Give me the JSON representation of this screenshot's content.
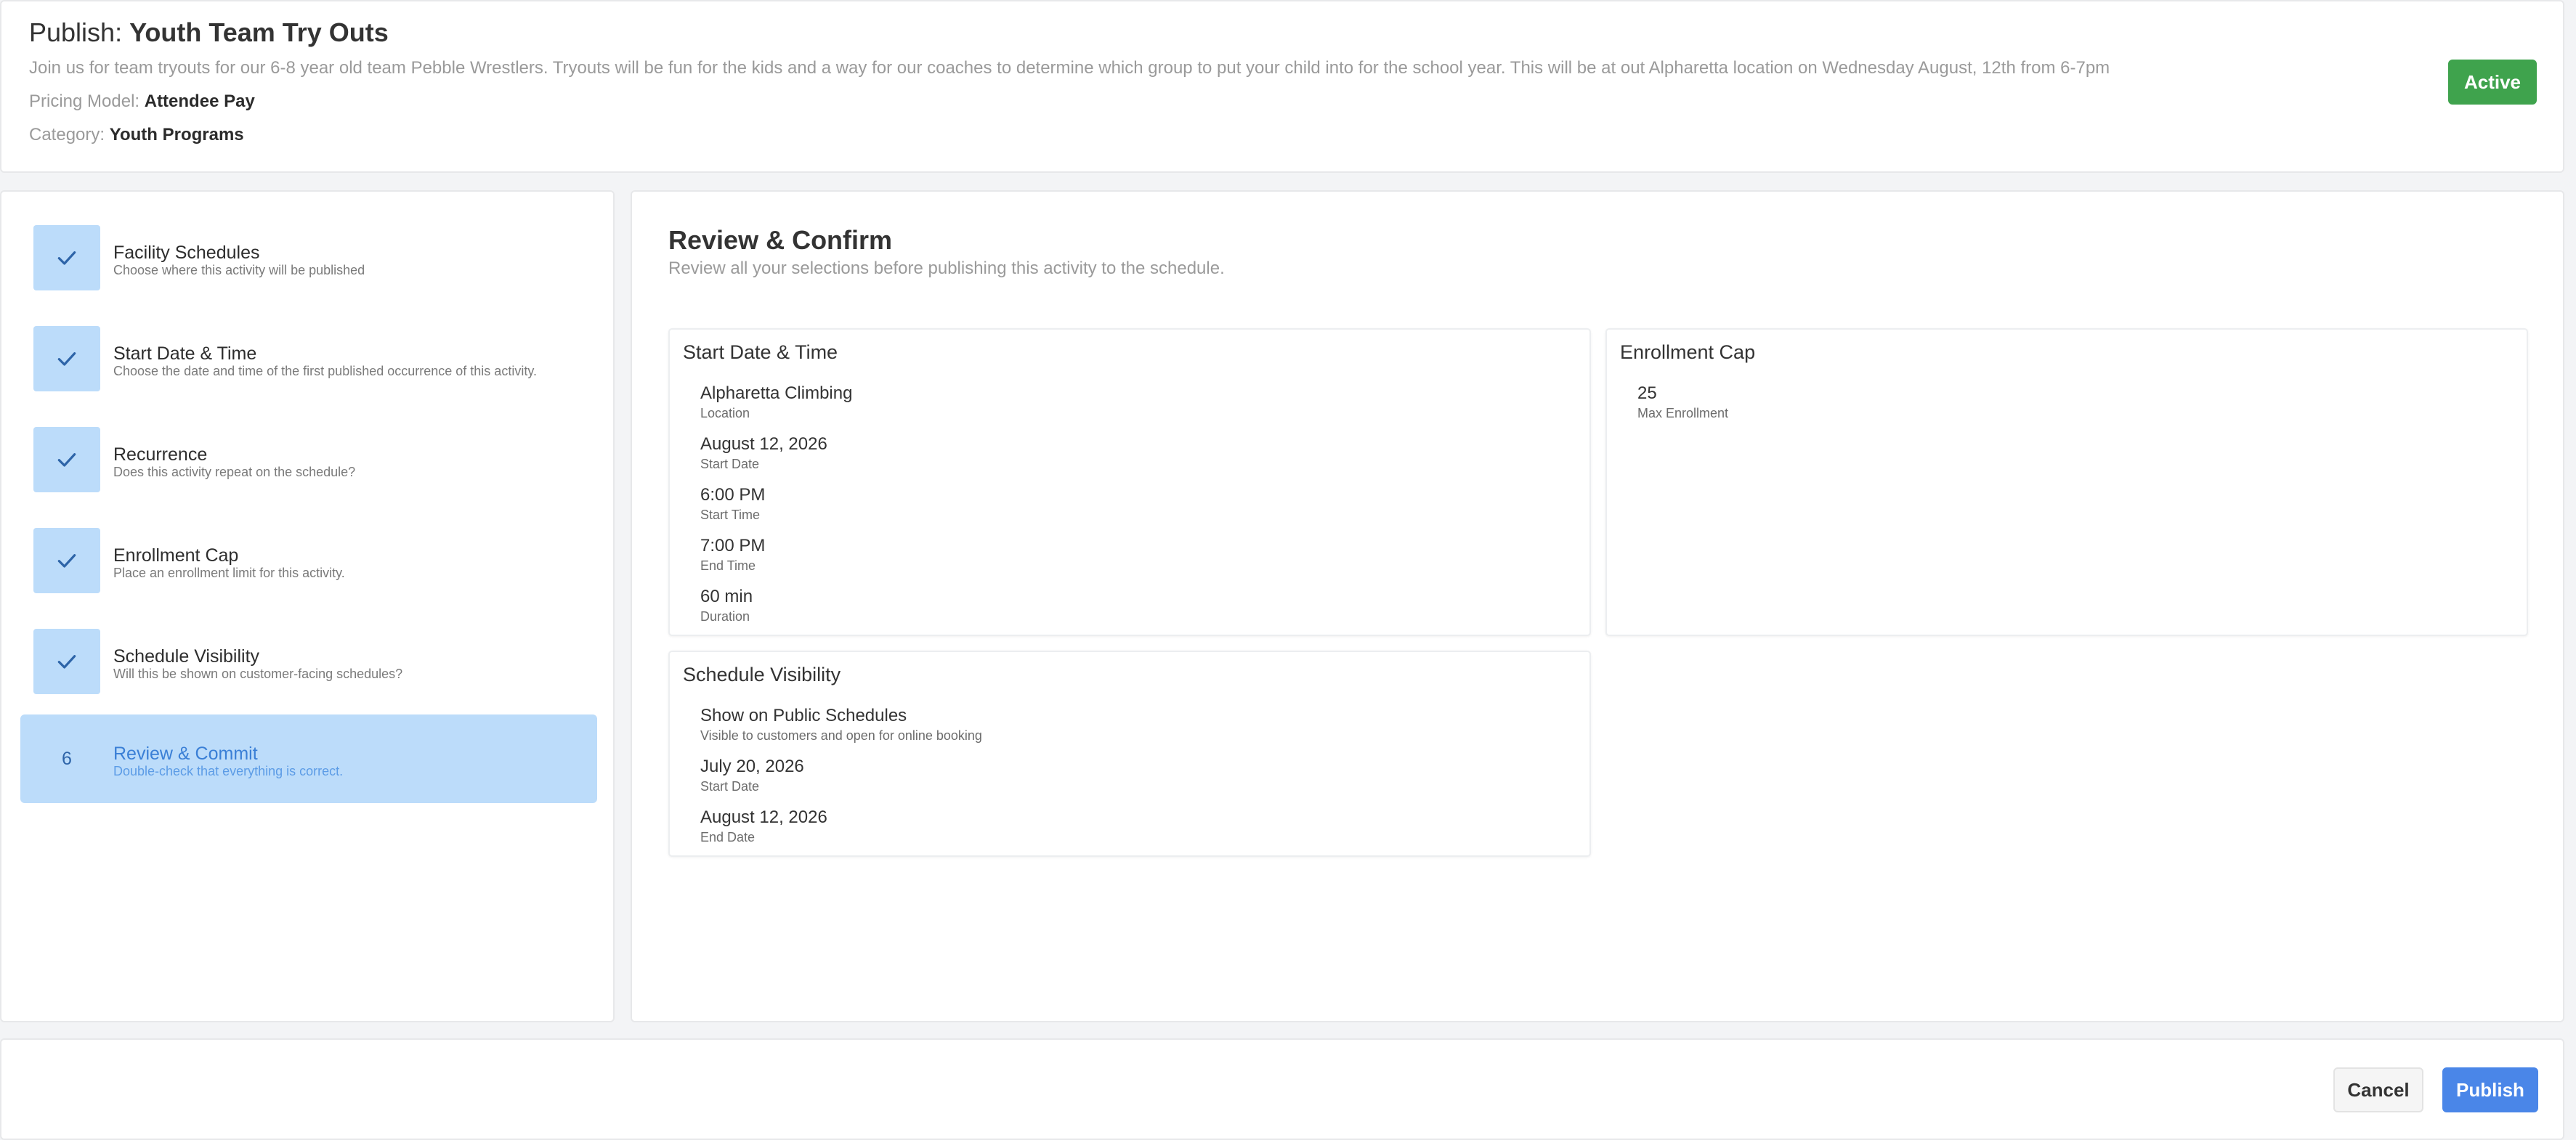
{
  "header": {
    "title_prefix": "Publish:",
    "title": "Youth Team Try Outs",
    "description": "Join us for team tryouts for our 6-8 year old team Pebble Wrestlers. Tryouts will be fun for the kids and a way for our coaches to determine which group to put your child into for the school year. This will be at out Alpharetta location on Wednesday August, 12th from 6-7pm",
    "pricing_label": "Pricing Model:",
    "pricing_value": "Attendee Pay",
    "category_label": "Category:",
    "category_value": "Youth Programs",
    "status": "Active"
  },
  "steps": [
    {
      "title": "Facility Schedules",
      "subtitle": "Choose where this activity will be published",
      "icon": "check-icon"
    },
    {
      "title": "Start Date & Time",
      "subtitle": "Choose the date and time of the first published occurrence of this activity.",
      "icon": "check-icon"
    },
    {
      "title": "Recurrence",
      "subtitle": "Does this activity repeat on the schedule?",
      "icon": "check-icon"
    },
    {
      "title": "Enrollment Cap",
      "subtitle": "Place an enrollment limit for this activity.",
      "icon": "check-icon"
    },
    {
      "title": "Schedule Visibility",
      "subtitle": "Will this be shown on customer-facing schedules?",
      "icon": "check-icon"
    },
    {
      "number": "6",
      "title": "Review & Commit",
      "subtitle": "Double-check that everything is correct."
    }
  ],
  "review": {
    "title": "Review & Confirm",
    "subtitle": "Review all your selections before publishing this activity to the schedule.",
    "start_card": {
      "title": "Start Date & Time",
      "fields": [
        {
          "value": "Alpharetta Climbing",
          "label": "Location"
        },
        {
          "value": "August 12, 2026",
          "label": "Start Date"
        },
        {
          "value": "6:00 PM",
          "label": "Start Time"
        },
        {
          "value": "7:00 PM",
          "label": "End Time"
        },
        {
          "value": "60 min",
          "label": "Duration"
        }
      ]
    },
    "enrollment_card": {
      "title": "Enrollment Cap",
      "fields": [
        {
          "value": "25",
          "label": "Max Enrollment"
        }
      ]
    },
    "visibility_card": {
      "title": "Schedule Visibility",
      "fields": [
        {
          "value": "Show on Public Schedules",
          "label": "Visible to customers and open for online booking"
        },
        {
          "value": "July 20, 2026",
          "label": "Start Date"
        },
        {
          "value": "August 12, 2026",
          "label": "End Date"
        }
      ]
    }
  },
  "footer": {
    "cancel_label": "Cancel",
    "publish_label": "Publish"
  },
  "colors": {
    "accent": "#4a86e8",
    "active_status": "#3fa34d",
    "step_highlight": "#bcdcfa",
    "check": "#2d64a8"
  }
}
